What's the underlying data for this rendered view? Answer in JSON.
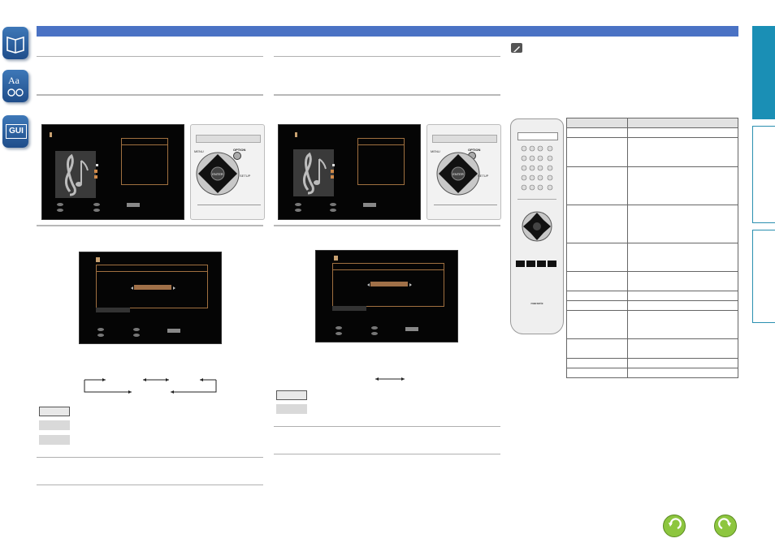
{
  "sidebar": {
    "tabs": [
      {
        "icon": "book-icon",
        "label": ""
      },
      {
        "icon": "glossary-icon",
        "label": "Aa"
      },
      {
        "icon": "gui-icon",
        "label": "GUI"
      }
    ]
  },
  "remote": {
    "option_label": "OPTION",
    "enter_label": "ENTER",
    "menu_label": "MENU",
    "setup_label": "SETUP",
    "brand": "marantz"
  },
  "colors": {
    "header_bar": "#4a72c4",
    "right_tab_active": "#1a8fb5",
    "gui_accent": "#a07040",
    "nav_icon": "#8dc63f"
  },
  "nav": {
    "back_icon": "back-arrow-icon",
    "forward_icon": "forward-arrow-icon"
  }
}
